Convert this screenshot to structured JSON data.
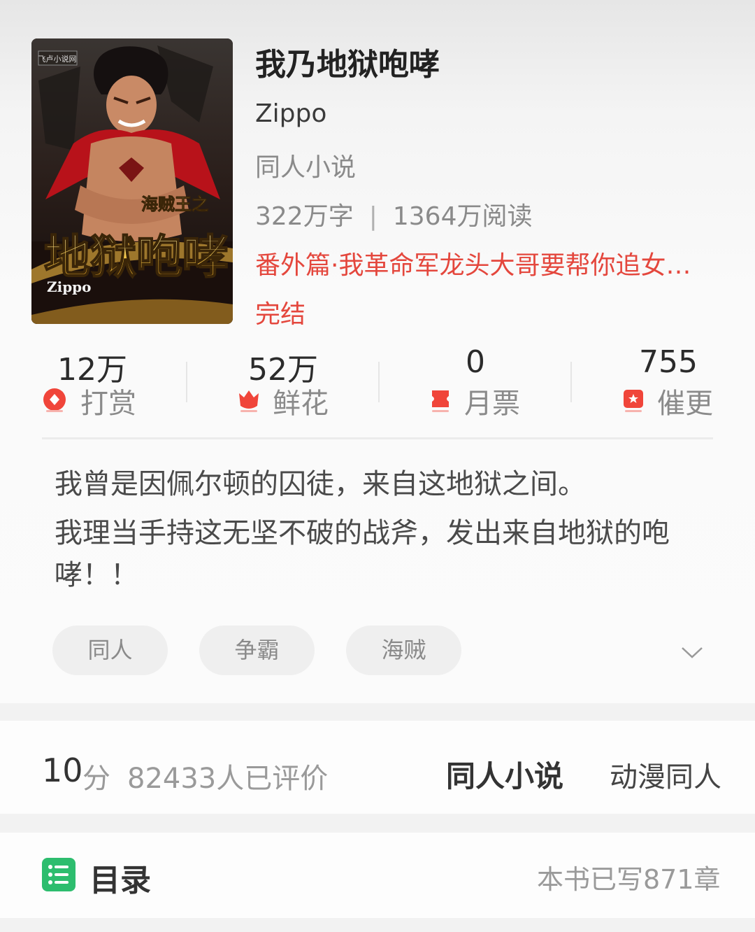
{
  "book": {
    "title": "我乃地狱咆哮",
    "author": "Zippo",
    "category": "同人小说",
    "word_count": "322万字",
    "reads": "1364万阅读",
    "latest_chapter": "番外篇·我革命军龙头大哥要帮你追女…",
    "status": "完结"
  },
  "cover": {
    "art_title": "地狱咆哮",
    "art_subtitle": "海贼王之",
    "art_author": "Zippo",
    "publisher_mark": "飞卢小说网"
  },
  "metrics": [
    {
      "value": "12万",
      "label": "打赏",
      "icon": "reward-icon",
      "color": "#f0453a"
    },
    {
      "value": "52万",
      "label": "鲜花",
      "icon": "flower-icon",
      "color": "#f0453a"
    },
    {
      "value": "0",
      "label": "月票",
      "icon": "ticket-icon",
      "color": "#f0453a"
    },
    {
      "value": "755",
      "label": "催更",
      "icon": "urge-icon",
      "color": "#f0453a"
    }
  ],
  "description": {
    "line1": "我曾是因佩尔顿的囚徒，来自这地狱之间。",
    "line2": "我理当手持这无坚不破的战斧，发出来自地狱的咆哮！！"
  },
  "tags": [
    "同人",
    "争霸",
    "海贼"
  ],
  "rating": {
    "score": "10",
    "unit": "分",
    "raters": "82433人已评价",
    "category_main": "同人小说",
    "category_sub": "动漫同人"
  },
  "toc": {
    "title": "目录",
    "chapter_count": "本书已写871章",
    "icon_color": "#2dbd6e"
  },
  "colors": {
    "accent": "#e4473d",
    "text_primary": "#222222",
    "text_secondary": "#8a8a8a"
  }
}
